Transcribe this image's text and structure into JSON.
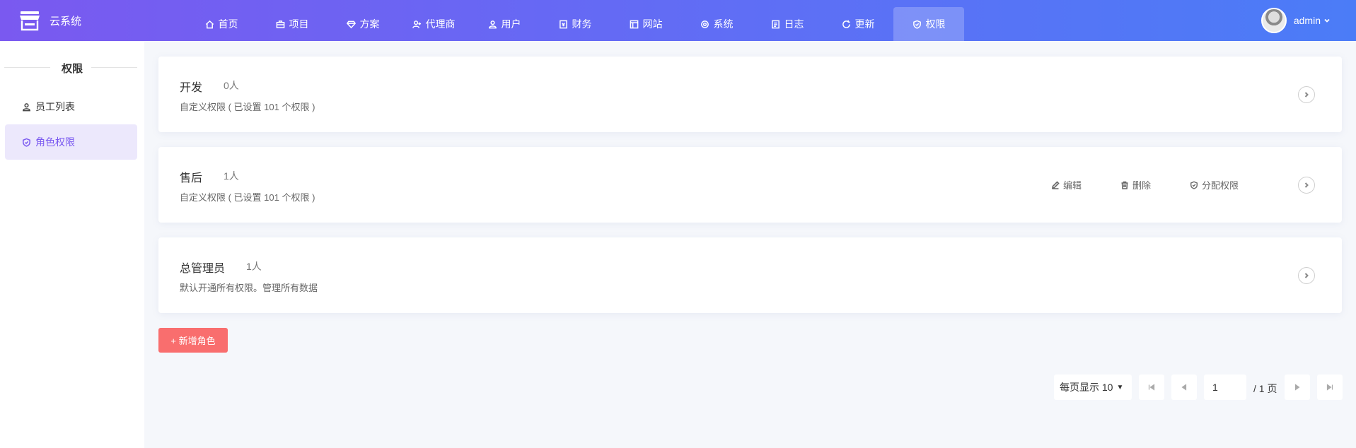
{
  "header": {
    "brand": "云系统",
    "nav": [
      {
        "label": "首页",
        "icon": "home-icon"
      },
      {
        "label": "项目",
        "icon": "briefcase-icon"
      },
      {
        "label": "方案",
        "icon": "diamond-icon"
      },
      {
        "label": "代理商",
        "icon": "user-plus-icon"
      },
      {
        "label": "用户",
        "icon": "users-icon"
      },
      {
        "label": "财务",
        "icon": "finance-icon"
      },
      {
        "label": "网站",
        "icon": "website-icon"
      },
      {
        "label": "系统",
        "icon": "gear-icon"
      },
      {
        "label": "日志",
        "icon": "log-icon"
      },
      {
        "label": "更新",
        "icon": "refresh-icon"
      },
      {
        "label": "权限",
        "icon": "shield-icon",
        "active": true
      }
    ],
    "user_name": "admin"
  },
  "sidebar": {
    "title": "权限",
    "items": [
      {
        "label": "员工列表",
        "icon": "user-icon"
      },
      {
        "label": "角色权限",
        "icon": "shield-icon",
        "active": true
      }
    ]
  },
  "roles": [
    {
      "name": "开发",
      "count": "0人",
      "desc": "自定义权限 ( 已设置 101 个权限 )"
    },
    {
      "name": "售后",
      "count": "1人",
      "desc": "自定义权限 ( 已设置 101 个权限 )"
    },
    {
      "name": "总管理员",
      "count": "1人",
      "desc": "默认开通所有权限。管理所有数据"
    }
  ],
  "role_actions": {
    "edit": "编辑",
    "delete": "删除",
    "assign": "分配权限"
  },
  "add_role_label": "+ 新增角色",
  "pager": {
    "page_size_label": "每页显示 10",
    "page": "1",
    "total_label": "/ 1 页"
  },
  "colors": {
    "accent": "#7a59f0",
    "header_end": "#4b7cf7",
    "add_button": "#f96e6e"
  }
}
